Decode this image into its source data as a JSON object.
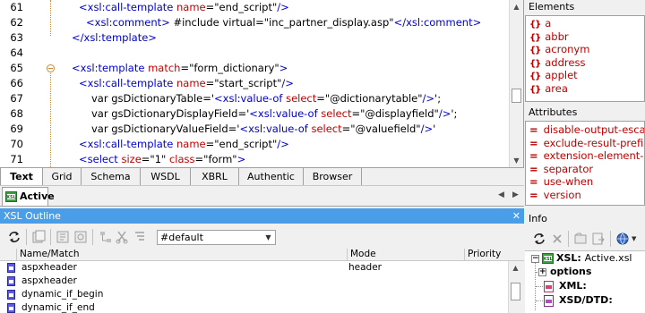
{
  "editor": {
    "line_numbers": [
      "61",
      "62",
      "63",
      "64",
      "65",
      "66",
      "67",
      "68",
      "69",
      "70",
      "71",
      "72"
    ],
    "lines": [
      {
        "indent": 18,
        "segs": [
          [
            "b",
            "<xsl:call-template "
          ],
          [
            "r",
            "name"
          ],
          [
            "s",
            "=\"end_script\""
          ],
          [
            "b",
            "/>"
          ]
        ]
      },
      {
        "indent": 26,
        "segs": [
          [
            "b",
            "<xsl:comment> "
          ],
          [
            "s",
            "#include virtual=\"inc_partner_display.asp\""
          ],
          [
            "b",
            "</xsl:comment>"
          ]
        ]
      },
      {
        "indent": 10,
        "segs": [
          [
            "b",
            "</xsl:template>"
          ]
        ]
      },
      {
        "indent": 0,
        "segs": []
      },
      {
        "indent": 10,
        "segs": [
          [
            "b",
            "<xsl:template "
          ],
          [
            "r",
            "match"
          ],
          [
            "s",
            "=\"form_dictionary\""
          ],
          [
            "b",
            ">"
          ]
        ]
      },
      {
        "indent": 18,
        "segs": [
          [
            "b",
            "<xsl:call-template "
          ],
          [
            "r",
            "name"
          ],
          [
            "s",
            "=\"start_script\""
          ],
          [
            "b",
            "/>"
          ]
        ]
      },
      {
        "indent": 32,
        "segs": [
          [
            "s",
            "var gsDictionaryTable='"
          ],
          [
            "b",
            "<xsl:value-of "
          ],
          [
            "r",
            "select"
          ],
          [
            "s",
            "=\"@dictionarytable\""
          ],
          [
            "b",
            "/>"
          ],
          [
            "s",
            "';"
          ]
        ]
      },
      {
        "indent": 32,
        "segs": [
          [
            "s",
            "var gsDictionaryDisplayField='"
          ],
          [
            "b",
            "<xsl:value-of "
          ],
          [
            "r",
            "select"
          ],
          [
            "s",
            "=\"@displayfield\""
          ],
          [
            "b",
            "/>"
          ],
          [
            "s",
            "';"
          ]
        ]
      },
      {
        "indent": 32,
        "segs": [
          [
            "s",
            "var gsDictionaryValueField='"
          ],
          [
            "b",
            "<xsl:value-of "
          ],
          [
            "r",
            "select"
          ],
          [
            "s",
            "=\"@valuefield\""
          ],
          [
            "b",
            "/>"
          ],
          [
            "s",
            "'"
          ]
        ]
      },
      {
        "indent": 18,
        "segs": [
          [
            "b",
            "<xsl:call-template "
          ],
          [
            "r",
            "name"
          ],
          [
            "s",
            "=\"end_script\""
          ],
          [
            "b",
            "/>"
          ]
        ]
      },
      {
        "indent": 18,
        "segs": [
          [
            "b",
            "<select "
          ],
          [
            "r",
            "size"
          ],
          [
            "s",
            "=\"1\" "
          ],
          [
            "r",
            "class"
          ],
          [
            "s",
            "=\"form\""
          ],
          [
            "b",
            ">"
          ]
        ]
      },
      {
        "indent": 26,
        "segs": [
          [
            "b",
            "<xsl:for-each "
          ],
          [
            "r",
            "select"
          ],
          [
            "s",
            "=\"option\""
          ],
          [
            "b",
            ">"
          ]
        ]
      }
    ]
  },
  "view_tabs": [
    "Text",
    "Grid",
    "Schema",
    "WSDL",
    "XBRL",
    "Authentic",
    "Browser"
  ],
  "doc_tab": "Active",
  "elements_panel": {
    "title": "Elements",
    "items": [
      "a",
      "abbr",
      "acronym",
      "address",
      "applet",
      "area"
    ]
  },
  "attributes_panel": {
    "title": "Attributes",
    "items": [
      "disable-output-escap",
      "exclude-result-prefixe",
      "extension-element-pr",
      "separator",
      "use-when",
      "version"
    ]
  },
  "outline": {
    "title": "XSL Outline",
    "close_glyph": "✕",
    "mode_value": "#default",
    "columns": [
      "Name/Match",
      "Mode",
      "Priority"
    ],
    "rows": [
      {
        "name": "aspxheader",
        "mode": "header"
      },
      {
        "name": "aspxheader",
        "mode": ""
      },
      {
        "name": "dynamic_if_begin",
        "mode": ""
      },
      {
        "name": "dynamic_if_end",
        "mode": ""
      }
    ]
  },
  "info": {
    "title": "Info",
    "xsl_label": "XSL:",
    "xsl_value": "Active.xsl",
    "options_label": "options",
    "xml_label": "XML:",
    "xsddtd_label": "XSD/DTD:"
  },
  "colors": {
    "tag_blue": "#0000d0",
    "attr_red": "#c00000",
    "outline_header": "#4a9ee8"
  }
}
